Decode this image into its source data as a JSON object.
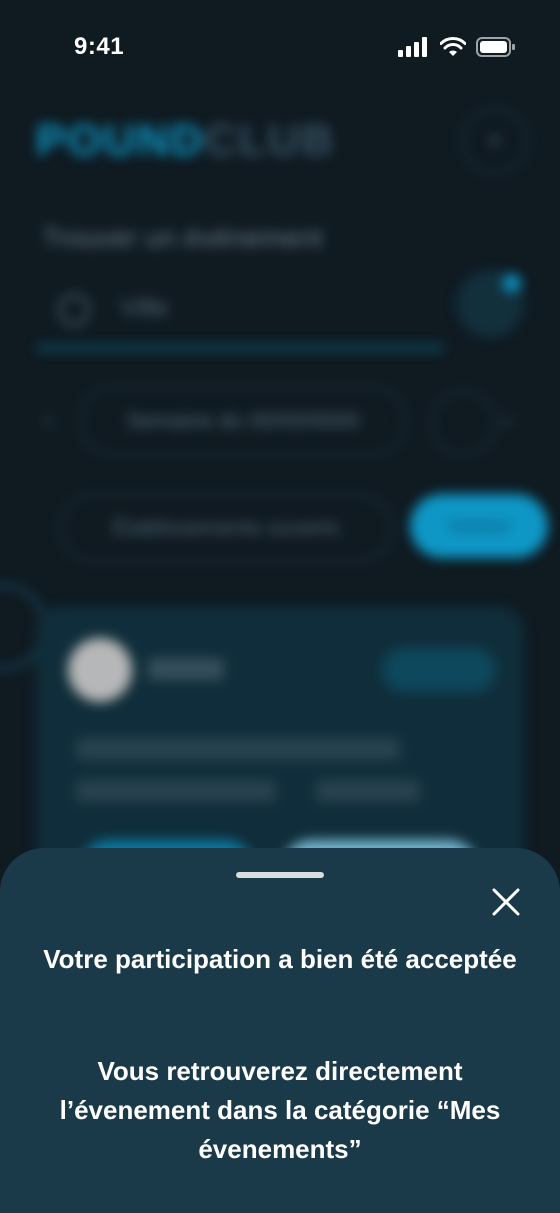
{
  "status_bar": {
    "time": "9:41",
    "icons": [
      "signal-icon",
      "wifi-icon",
      "battery-icon"
    ]
  },
  "background": {
    "blurred": true
  },
  "sheet": {
    "title": "Votre participation a bien été acceptée",
    "message": "Vous retrouverez directement l’évenement dans la catégorie “Mes évenements”",
    "close_icon": "close-icon"
  },
  "colors": {
    "background": "#0f1a21",
    "accent": "#0ea5d8",
    "sheet": "#1b3a49",
    "text": "#ffffff"
  }
}
